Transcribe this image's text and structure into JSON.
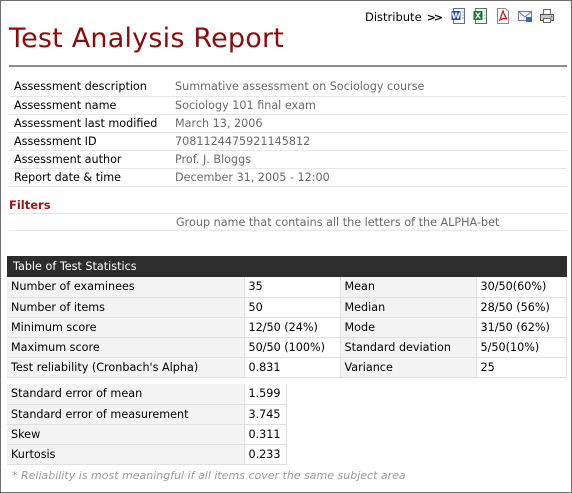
{
  "toolbar": {
    "distribute_label": "Distribute",
    "chevron": ">>",
    "icons": [
      "word-export-icon",
      "excel-export-icon",
      "pdf-export-icon",
      "email-icon",
      "print-icon"
    ]
  },
  "page_title": "Test Analysis Report",
  "colors": {
    "title": "#8b0b0b",
    "filters_heading": "#a01414",
    "stats_header_bg": "#2d2d2d"
  },
  "info": [
    {
      "label": "Assessment description",
      "value": "Summative assessment on Sociology course"
    },
    {
      "label": "Assessment name",
      "value": "Sociology 101 final exam"
    },
    {
      "label": "Assessment last modified",
      "value": "March 13, 2006"
    },
    {
      "label": "Assessment ID",
      "value": "7081124475921145812"
    },
    {
      "label": "Assessment author",
      "value": "Prof. J. Bloggs"
    },
    {
      "label": "Report date & time",
      "value": "December 31, 2005 - 12:00"
    }
  ],
  "filters": {
    "heading": "Filters",
    "value": "Group name that contains all the letters of the ALPHA-bet"
  },
  "stats": {
    "heading": "Table of Test Statistics",
    "rows": [
      {
        "k1": "Number of examinees",
        "v1": "35",
        "k2": "Mean",
        "v2": "30/50(60%)"
      },
      {
        "k1": "Number of items",
        "v1": "50",
        "k2": "Median",
        "v2": "28/50 (56%)"
      },
      {
        "k1": "Minimum score",
        "v1": "12/50 (24%)",
        "k2": "Mode",
        "v2": "31/50 (62%)"
      },
      {
        "k1": "Maximum score",
        "v1": "50/50 (100%)",
        "k2": "Standard deviation",
        "v2": "5/50(10%)"
      },
      {
        "k1": "Test reliability (Cronbach's Alpha)",
        "v1": "0.831",
        "k2": "Variance",
        "v2": "25"
      }
    ],
    "extra_rows": [
      {
        "k": "Standard error of mean",
        "v": "1.599"
      },
      {
        "k": "Standard error of measurement",
        "v": "3.745"
      },
      {
        "k": "Skew",
        "v": "0.311"
      },
      {
        "k": "Kurtosis",
        "v": "0.233"
      }
    ],
    "footnote": "* Reliability is most meaningful if all items cover the same subject area"
  }
}
